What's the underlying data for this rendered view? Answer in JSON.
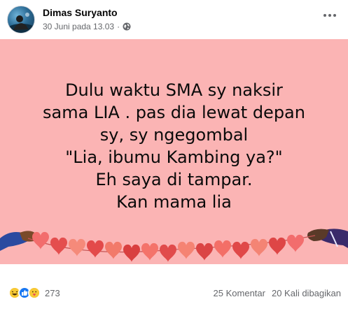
{
  "post": {
    "author": "Dimas Suryanto",
    "timestamp": "30 Juni pada 13.03",
    "separator": "·",
    "privacy_icon": "globe-icon",
    "more_icon": "more-options-icon"
  },
  "image": {
    "background_color": "#fbb4b4",
    "lines": [
      "Dulu waktu SMA sy naksir",
      "sama LIA . pas dia lewat depan",
      "sy, sy ngegombal",
      "\"Lia, ibumu Kambing ya?\"",
      "Eh saya di tampar.",
      "Kan mama lia"
    ]
  },
  "footer": {
    "reaction_icons": [
      "haha-icon",
      "like-icon",
      "care-icon"
    ],
    "reaction_count": "273",
    "comments": "25 Komentar",
    "shares": "20 Kali dibagikan"
  }
}
